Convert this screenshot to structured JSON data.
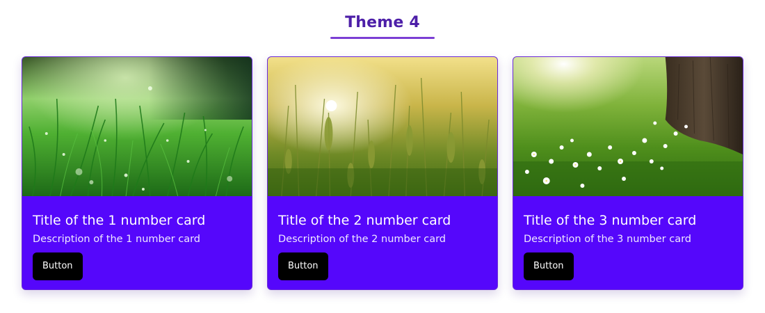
{
  "header": {
    "title": "Theme 4"
  },
  "colors": {
    "accent": "#5507fb",
    "heading": "#4d1fa8",
    "button": "#000000"
  },
  "cards": [
    {
      "image": "grass-dew-photo",
      "title": "Title of the 1 number card",
      "description": "Description of the 1 number card",
      "button_label": "Button"
    },
    {
      "image": "wheat-field-photo",
      "title": "Title of the 2 number card",
      "description": "Description of the 2 number card",
      "button_label": "Button"
    },
    {
      "image": "meadow-tree-flowers-photo",
      "title": "Title of the 3 number card",
      "description": "Description of the 3 number card",
      "button_label": "Button"
    }
  ]
}
